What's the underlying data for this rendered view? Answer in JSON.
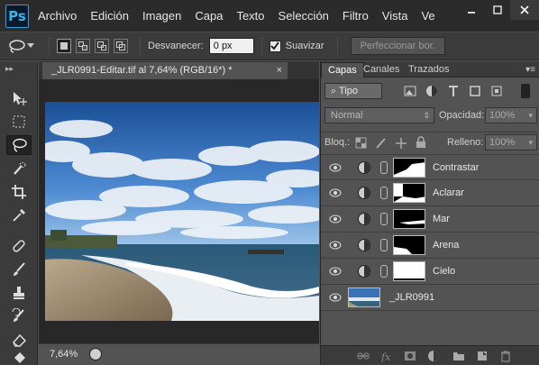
{
  "menubar": {
    "logo": "Ps",
    "items": [
      "Archivo",
      "Edición",
      "Imagen",
      "Capa",
      "Texto",
      "Selección",
      "Filtro",
      "Vista",
      "Ve"
    ]
  },
  "options": {
    "feather_label": "Desvanecer:",
    "feather_value": "0 px",
    "smooth_label": "Suavizar",
    "smooth_checked": true,
    "refine_label": "Perfeccionar bor."
  },
  "document": {
    "tab_title": "_JLR0991-Editar.tif al 7,64% (RGB/16*) *",
    "close_glyph": "×",
    "zoom": "7,64%"
  },
  "panel": {
    "tabs": [
      "Capas",
      "Canales",
      "Trazados"
    ],
    "filter_label": "Tipo",
    "blend_mode": "Normal",
    "opacity_label": "Opacidad:",
    "opacity_value": "100%",
    "lock_label": "Bloq.:",
    "fill_label": "Relleno:",
    "fill_value": "100%",
    "layers": [
      {
        "name": "Contrastar",
        "type": "curves-adjustment",
        "visible": true
      },
      {
        "name": "Aclarar",
        "type": "curves-adjustment",
        "visible": true
      },
      {
        "name": "Mar",
        "type": "curves-adjustment",
        "visible": true
      },
      {
        "name": "Arena",
        "type": "curves-adjustment",
        "visible": true
      },
      {
        "name": "Cielo",
        "type": "curves-adjustment",
        "visible": true
      },
      {
        "name": "_JLR0991",
        "type": "background-image",
        "visible": true
      }
    ]
  },
  "colors": {
    "accent": "#2ea2dc",
    "chrome_dark": "#2b2b2b",
    "panel": "#535353",
    "toolbar": "#3b3b3b"
  }
}
